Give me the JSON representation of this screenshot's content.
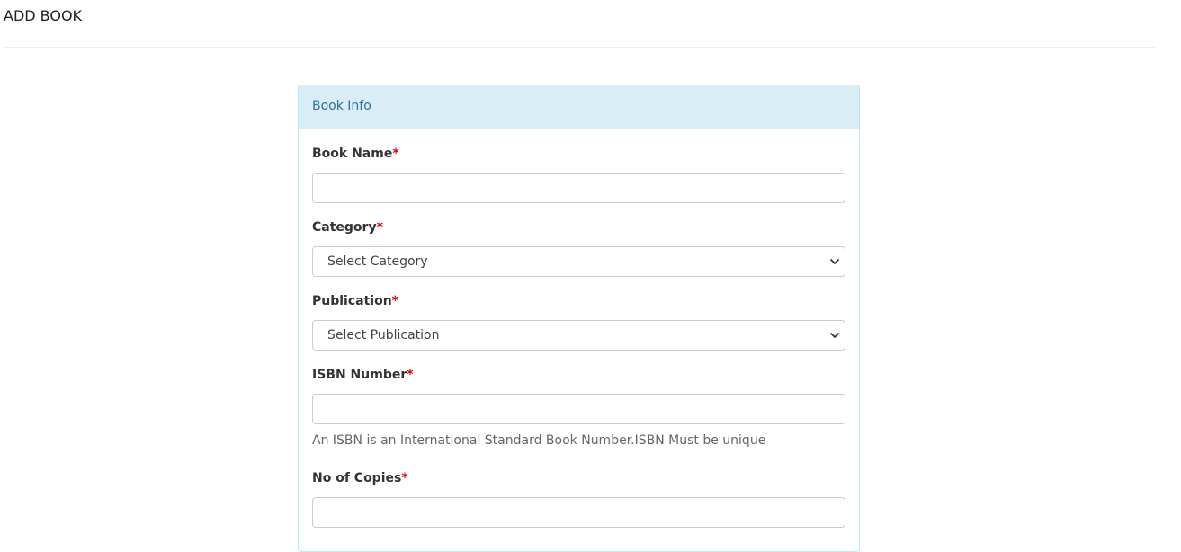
{
  "page": {
    "title": "ADD BOOK"
  },
  "panel": {
    "heading": "Book Info"
  },
  "form": {
    "book_name": {
      "label": "Book Name",
      "required_mark": "*",
      "value": ""
    },
    "category": {
      "label": "Category",
      "required_mark": "*",
      "selected": "Select Category"
    },
    "publication": {
      "label": "Publication",
      "required_mark": "*",
      "selected": "Select Publication"
    },
    "isbn": {
      "label": "ISBN Number",
      "required_mark": "*",
      "value": "",
      "help": "An ISBN is an International Standard Book Number.ISBN Must be unique"
    },
    "copies": {
      "label": "No of Copies",
      "required_mark": "*",
      "value": ""
    }
  },
  "icons": {
    "select_chevron": "chevron-down-icon"
  },
  "colors": {
    "panel_heading_bg": "#d9edf7",
    "panel_border": "#bce8f1",
    "panel_heading_text": "#31708f",
    "required": "#e00000"
  }
}
